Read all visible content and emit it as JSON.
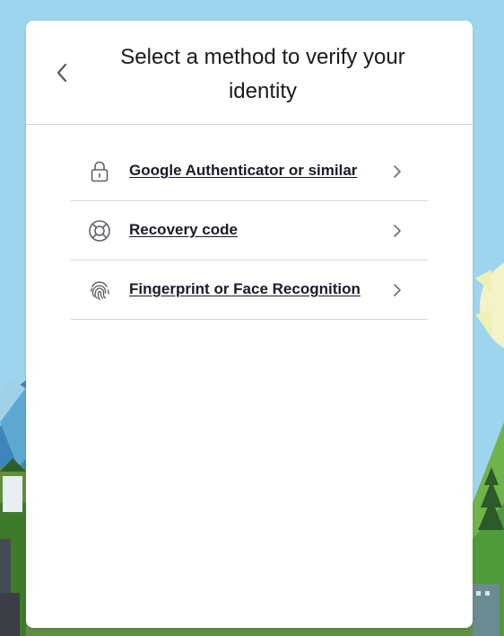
{
  "dialog": {
    "title": "Select a method to verify your identity",
    "back_icon": "chevron-left-icon"
  },
  "methods": [
    {
      "label": "Google Authenticator or similar",
      "icon": "lock-icon"
    },
    {
      "label": "Recovery code",
      "icon": "lifebuoy-icon"
    },
    {
      "label": "Fingerprint or Face Recognition",
      "icon": "fingerprint-icon"
    }
  ],
  "colors": {
    "sky": "#9ed5ee",
    "card": "#ffffff",
    "text": "#1a1a2a",
    "divider": "#d6d6da",
    "icon": "#5f6168"
  }
}
